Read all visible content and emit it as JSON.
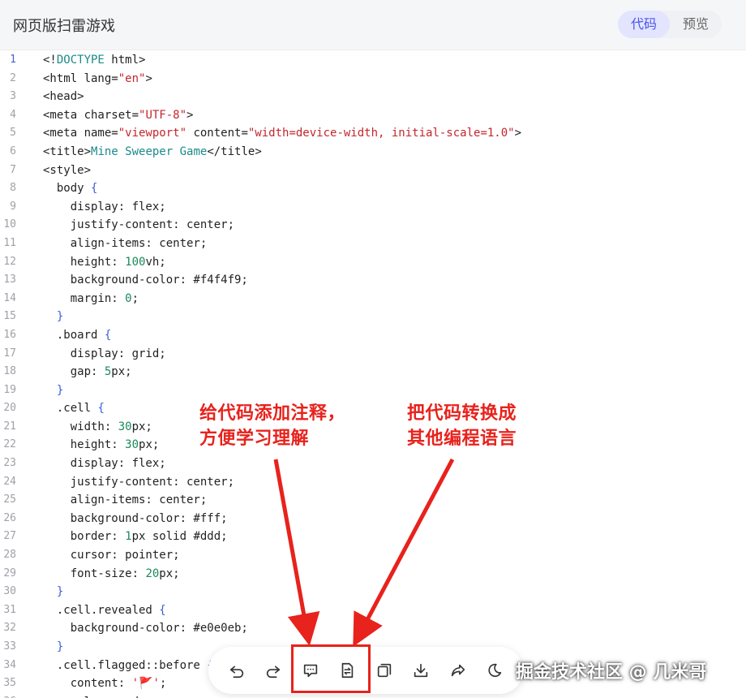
{
  "header": {
    "title": "网页版扫雷游戏",
    "tabs": [
      {
        "label": "代码",
        "active": true
      },
      {
        "label": "预览",
        "active": false
      }
    ]
  },
  "code_lines": [
    "<!DOCTYPE html>",
    "<html lang=\"en\">",
    "<head>",
    "<meta charset=\"UTF-8\">",
    "<meta name=\"viewport\" content=\"width=device-width, initial-scale=1.0\">",
    "<title>Mine Sweeper Game</title>",
    "<style>",
    "  body {",
    "    display: flex;",
    "    justify-content: center;",
    "    align-items: center;",
    "    height: 100vh;",
    "    background-color: #f4f4f9;",
    "    margin: 0;",
    "  }",
    "  .board {",
    "    display: grid;",
    "    gap: 5px;",
    "  }",
    "  .cell {",
    "    width: 30px;",
    "    height: 30px;",
    "    display: flex;",
    "    justify-content: center;",
    "    align-items: center;",
    "    background-color: #fff;",
    "    border: 1px solid #ddd;",
    "    cursor: pointer;",
    "    font-size: 20px;",
    "  }",
    "  .cell.revealed {",
    "    background-color: #e0e0eb;",
    "  }",
    "  .cell.flagged::before {",
    "    content: '🚩';",
    "    color: red;"
  ],
  "annotations": {
    "add_comments": [
      "给代码添加注释，",
      "方便学习理解"
    ],
    "convert_language": [
      "把代码转换成",
      "其他编程语言"
    ]
  },
  "toolbar": {
    "buttons": [
      {
        "icon": "undo-icon",
        "name": "undo-button"
      },
      {
        "icon": "redo-icon",
        "name": "redo-button"
      },
      {
        "icon": "comment-icon",
        "name": "add-comment-button"
      },
      {
        "icon": "convert-icon",
        "name": "convert-code-button"
      },
      {
        "icon": "copy-icon",
        "name": "copy-button"
      },
      {
        "icon": "download-icon",
        "name": "download-button"
      },
      {
        "icon": "share-icon",
        "name": "share-button"
      },
      {
        "icon": "theme-moon-icon",
        "name": "theme-toggle-button"
      }
    ]
  },
  "watermark": "掘金技术社区 @ 几米哥",
  "colors": {
    "accent": "#4d53e8",
    "annotation_red": "#e8221c",
    "string": "#c3262b",
    "number": "#1a8a5a",
    "brace": "#3b5fd6"
  }
}
